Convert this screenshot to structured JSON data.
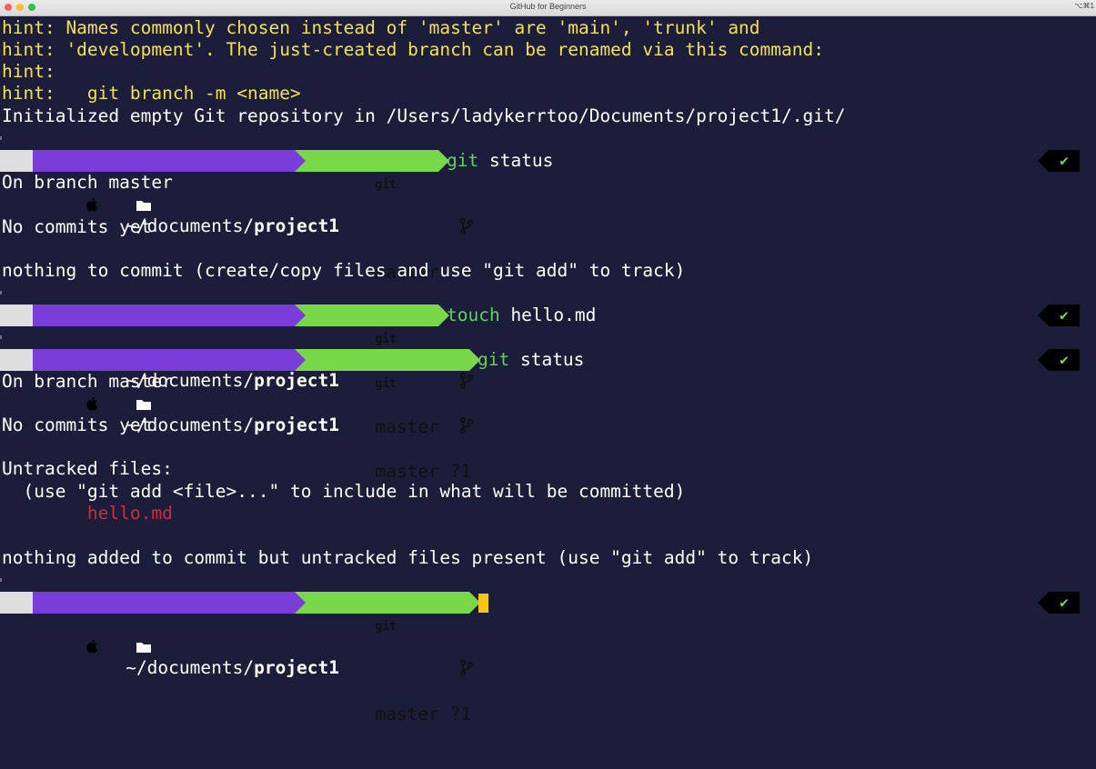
{
  "window": {
    "title": "GitHub for Beginners",
    "shortcut": "⌥⌘1"
  },
  "output": {
    "hint1": "hint: Names commonly chosen instead of 'master' are 'main', 'trunk' and",
    "hint2": "hint: 'development'. The just-created branch can be renamed via this command:",
    "hint3": "hint:",
    "hint4": "hint:   git branch -m <name>",
    "init": "Initialized empty Git repository in /Users/ladykerrtoo/Documents/project1/.git/",
    "status1_branch": "On branch master",
    "status1_nocommits": "No commits yet",
    "status1_nothing": "nothing to commit (create/copy files and use \"git add\" to track)",
    "status2_branch": "On branch master",
    "status2_nocommits": "No commits yet",
    "status2_untracked_header": "Untracked files:",
    "status2_untracked_hint": "  (use \"git add <file>...\" to include in what will be committed)",
    "status2_file": "        hello.md",
    "status2_nothing": "nothing added to commit but untracked files present (use \"git add\" to track)"
  },
  "prompt": {
    "dir_prefix": "~/documents/",
    "dir_name": "project1",
    "git_label": "git",
    "branch": "master",
    "branch_dirty": "master ?1",
    "status_ok": "✔"
  },
  "commands": {
    "cmd1_name": "git",
    "cmd1_arg": " status",
    "cmd2_name": "touch",
    "cmd2_arg": " hello.md",
    "cmd3_name": "git",
    "cmd3_arg": " status"
  },
  "colors": {
    "background": "#1c1d3a",
    "hint": "#f5e14b",
    "dir_segment": "#7a3dd9",
    "git_segment": "#79d84a",
    "untracked_file": "#c8303d",
    "cursor": "#f5c518"
  }
}
